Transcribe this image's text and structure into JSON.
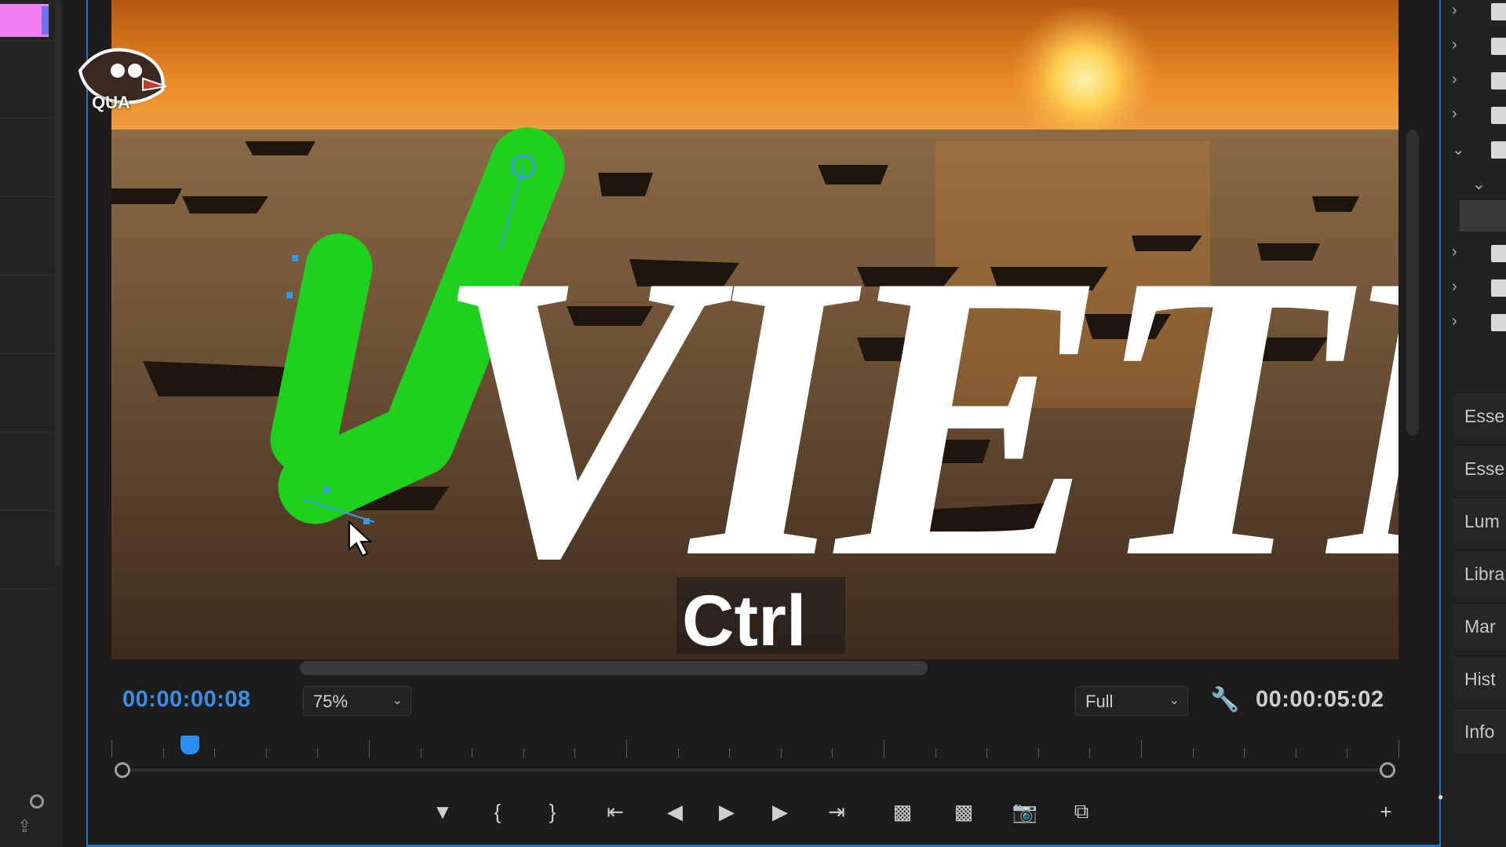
{
  "monitor": {
    "video": {
      "title_text": "VIETNA",
      "caption_text": "Ctrl",
      "logo_text": "QUA"
    },
    "current_timecode": "00:00:00:08",
    "zoom_level": "75%",
    "playback_resolution": "Full",
    "duration_timecode": "00:00:05:02",
    "accent_color": "#3b8fe3",
    "controls": [
      {
        "name": "add-marker",
        "icon": "marker-icon"
      },
      {
        "name": "mark-in",
        "icon": "mark-in-icon"
      },
      {
        "name": "mark-out",
        "icon": "mark-out-icon"
      },
      {
        "name": "go-to-in",
        "icon": "go-to-in-icon"
      },
      {
        "name": "step-back",
        "icon": "step-back-icon"
      },
      {
        "name": "play",
        "icon": "play-icon"
      },
      {
        "name": "step-forward",
        "icon": "step-forward-icon"
      },
      {
        "name": "go-to-out",
        "icon": "go-to-out-icon"
      },
      {
        "name": "lift",
        "icon": "lift-icon"
      },
      {
        "name": "extract",
        "icon": "extract-icon"
      },
      {
        "name": "export-frame",
        "icon": "camera-icon"
      },
      {
        "name": "comparison-view",
        "icon": "compare-icon"
      },
      {
        "name": "button-editor",
        "icon": "plus-icon"
      }
    ]
  },
  "right_panel": {
    "tabs": [
      "Esse",
      "Esse",
      "Lum",
      "Libra",
      "Mar",
      "Hist",
      "Info"
    ]
  }
}
